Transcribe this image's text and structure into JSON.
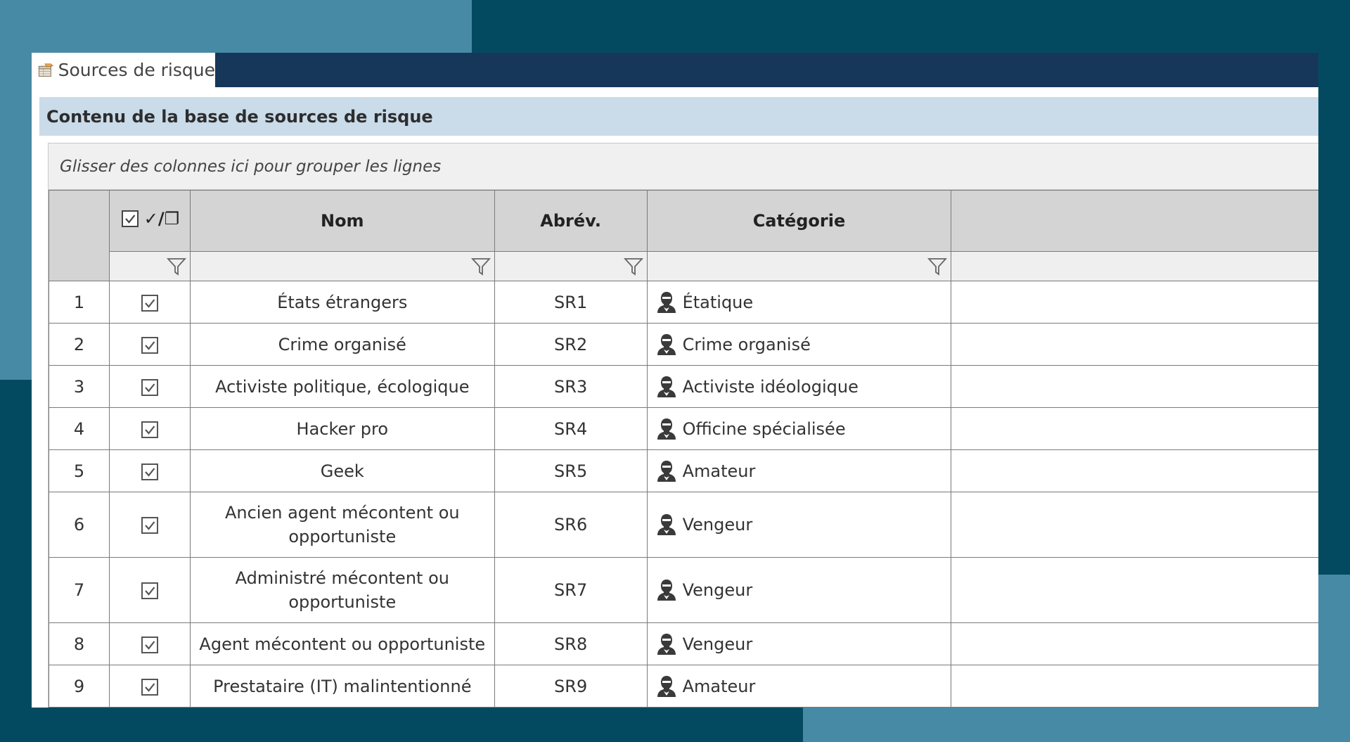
{
  "tab": {
    "label": "Sources de risque",
    "icon": "table-icon"
  },
  "section": {
    "title": "Contenu de la base de sources de risque"
  },
  "grid": {
    "group_hint": "Glisser des colonnes ici pour grouper les lignes",
    "columns": {
      "check": "✓/❐",
      "nom": "Nom",
      "abrev": "Abrév.",
      "categorie": "Catégorie"
    },
    "rows": [
      {
        "num": "1",
        "checked": true,
        "nom": "États étrangers",
        "abrev": "SR1",
        "categorie": "Étatique"
      },
      {
        "num": "2",
        "checked": true,
        "nom": "Crime organisé",
        "abrev": "SR2",
        "categorie": "Crime organisé"
      },
      {
        "num": "3",
        "checked": true,
        "nom": "Activiste politique, écologique",
        "abrev": "SR3",
        "categorie": "Activiste idéologique"
      },
      {
        "num": "4",
        "checked": true,
        "nom": "Hacker pro",
        "abrev": "SR4",
        "categorie": "Officine spécialisée"
      },
      {
        "num": "5",
        "checked": true,
        "nom": "Geek",
        "abrev": "SR5",
        "categorie": "Amateur"
      },
      {
        "num": "6",
        "checked": true,
        "nom": "Ancien agent mécontent ou opportuniste",
        "abrev": "SR6",
        "categorie": "Vengeur"
      },
      {
        "num": "7",
        "checked": true,
        "nom": "Administré mécontent ou opportuniste",
        "abrev": "SR7",
        "categorie": "Vengeur"
      },
      {
        "num": "8",
        "checked": true,
        "nom": "Agent mécontent ou opportuniste",
        "abrev": "SR8",
        "categorie": "Vengeur"
      },
      {
        "num": "9",
        "checked": true,
        "nom": "Prestataire (IT) malintentionné",
        "abrev": "SR9",
        "categorie": "Amateur"
      }
    ]
  },
  "colors": {
    "background": "#034a61",
    "background_accent": "#478aa6",
    "tabbar": "#17375a",
    "section_header": "#cadbea"
  }
}
